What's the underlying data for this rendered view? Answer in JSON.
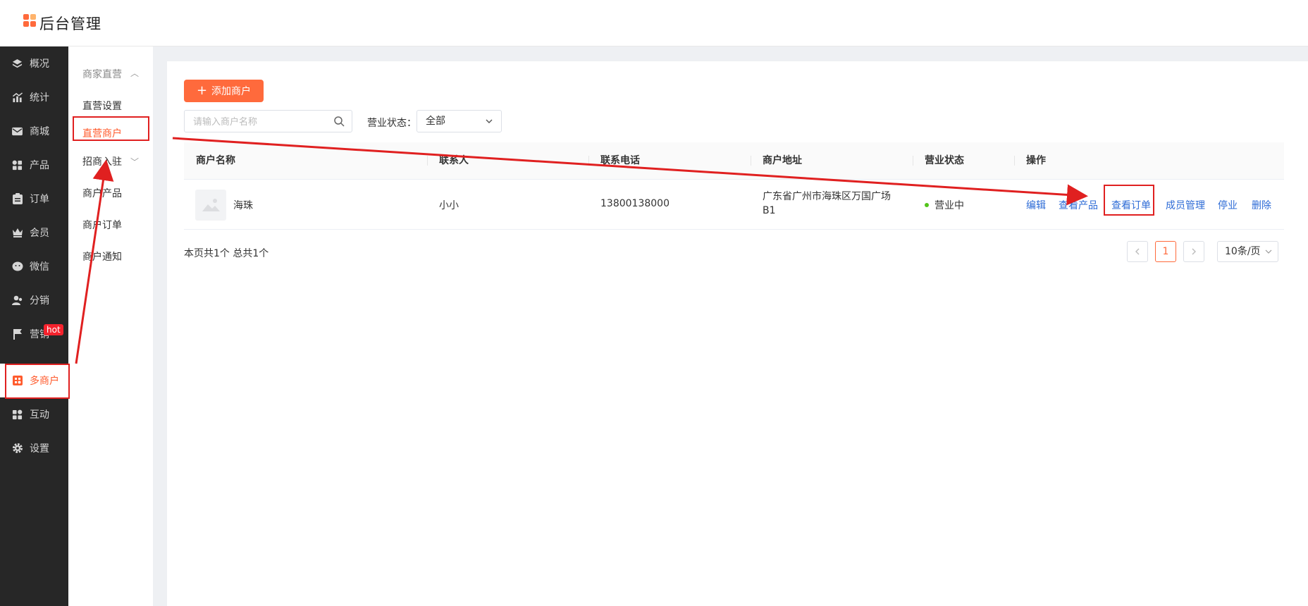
{
  "header": {
    "title": "后台管理"
  },
  "sidebar": {
    "items": [
      {
        "label": "概况",
        "icon": "layers-icon"
      },
      {
        "label": "统计",
        "icon": "chart-icon"
      },
      {
        "label": "商城",
        "icon": "mail-icon"
      },
      {
        "label": "产品",
        "icon": "grid-icon"
      },
      {
        "label": "订单",
        "icon": "clipboard-icon"
      },
      {
        "label": "会员",
        "icon": "crown-icon"
      },
      {
        "label": "微信",
        "icon": "wechat-icon"
      },
      {
        "label": "分销",
        "icon": "users-icon"
      },
      {
        "label": "营销",
        "icon": "flag-icon"
      },
      {
        "label": "多商户",
        "icon": "store-icon",
        "active": true
      },
      {
        "label": "互动",
        "icon": "grid-icon"
      },
      {
        "label": "设置",
        "icon": "gear-icon"
      }
    ],
    "hot_badge": "hot"
  },
  "subnav": {
    "group1": "商家直营",
    "item1": "直营设置",
    "item2": "直营商户",
    "group2": "招商入驻",
    "item3": "商户产品",
    "item4": "商户订单",
    "item5": "商户通知"
  },
  "toolbar": {
    "add_label": "添加商户",
    "search_placeholder": "请输入商户名称",
    "status_label": "营业状态：",
    "status_value": "全部"
  },
  "table": {
    "columns": [
      "商户名称",
      "联系人",
      "联系电话",
      "商户地址",
      "营业状态",
      "操作"
    ],
    "rows": [
      {
        "name": "海珠",
        "contact": "小小",
        "phone": "13800138000",
        "address": "广东省广州市海珠区万国广场B1",
        "status": "营业中",
        "status_color": "#52c41a",
        "actions": [
          "编辑",
          "查看产品",
          "查看订单",
          "成员管理",
          "停业",
          "删除"
        ]
      }
    ]
  },
  "footer": {
    "summary": "本页共1个 总共1个",
    "current_page": "1",
    "page_size": "10条/页"
  },
  "colors": {
    "accent": "#ff6a3c",
    "link": "#2d6bd6",
    "annotation": "#e02020"
  }
}
